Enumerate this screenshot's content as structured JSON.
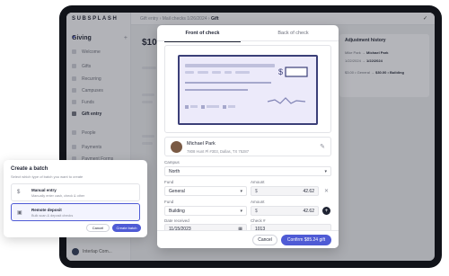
{
  "app": {
    "logo": "SUBSPLASH",
    "section": "Giving",
    "org_name": "Interlap Com..."
  },
  "sidebar": {
    "items": [
      {
        "label": "Welcome"
      },
      {
        "label": "Gifts"
      },
      {
        "label": "Recurring"
      },
      {
        "label": "Campuses"
      },
      {
        "label": "Funds"
      },
      {
        "label": "Gift entry"
      },
      {
        "label": "People"
      },
      {
        "label": "Payments"
      },
      {
        "label": "Payment Forms"
      }
    ]
  },
  "breadcrumb": {
    "part1": "Gift entry",
    "sep": "›",
    "part2": "Mail checks 1/26/2024",
    "part3": "Gift"
  },
  "background": {
    "amount": "$10",
    "adjustment_history_title": "Adjustment history",
    "adj_rows": [
      {
        "left": "Mike Park",
        "right": "Michael Park"
      },
      {
        "left": "1/22/2024",
        "right": "1/22/2024"
      },
      {
        "left": "$3.00 • General",
        "right": "$30.00 • Building"
      }
    ]
  },
  "modal": {
    "tabs": [
      {
        "label": "Front of check",
        "active": true
      },
      {
        "label": "Back of check",
        "active": false
      }
    ],
    "check_dollar_sign": "$",
    "payer": {
      "name": "Michael Park",
      "address": "7808 Hunt Pl #303, Dallas, TX 75287"
    },
    "campus": {
      "label": "Campus",
      "value": "North"
    },
    "fund_rows": [
      {
        "fund_label": "Fund",
        "fund_value": "General",
        "amount_label": "Amount",
        "currency": "$",
        "amount": "42.62",
        "action": "remove"
      },
      {
        "fund_label": "Fund",
        "fund_value": "Building",
        "amount_label": "Amount",
        "currency": "$",
        "amount": "42.62",
        "action": "add"
      }
    ],
    "date_received": {
      "label": "Date received",
      "value": "11/15/2023"
    },
    "check_number": {
      "label": "Check #",
      "value": "1013"
    },
    "cancel_label": "Cancel",
    "confirm_label": "Confirm $85.24 gift"
  },
  "batch_card": {
    "title": "Create a batch",
    "subtitle": "Select which type of batch you want to create",
    "options": [
      {
        "title": "Manual entry",
        "desc": "Manually enter cash, check & other",
        "selected": false
      },
      {
        "title": "Remote deposit",
        "desc": "Bulk scan & deposit checks",
        "selected": true
      }
    ],
    "cancel_label": "Cancel",
    "create_label": "Create batch"
  },
  "colors": {
    "accent": "#4f5bd5",
    "check_border": "#3b3f78",
    "check_fill": "#eceafa",
    "device": "#111319"
  }
}
